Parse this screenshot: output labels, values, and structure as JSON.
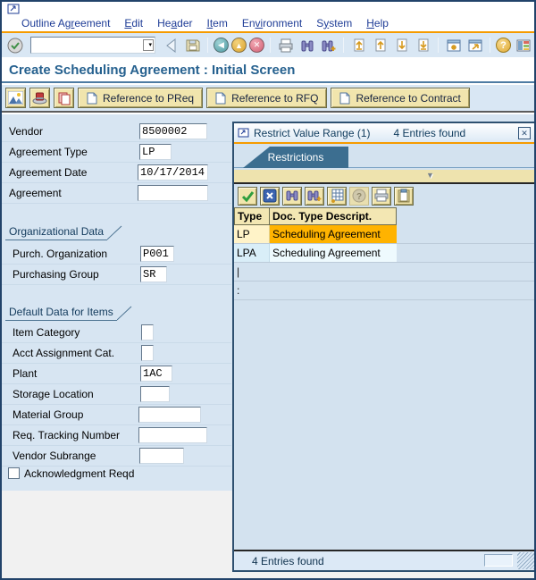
{
  "menu_bar": {
    "items": [
      {
        "label": "Outline Agreement",
        "accel": "gr"
      },
      {
        "label": "Edit",
        "accel": "E"
      },
      {
        "label": "Header",
        "accel": "a"
      },
      {
        "label": "Item",
        "accel": "It"
      },
      {
        "label": "Environment",
        "accel": "vi"
      },
      {
        "label": "System",
        "accel": "y"
      },
      {
        "label": "Help",
        "accel": "H"
      }
    ]
  },
  "toolbar": {
    "command_value": ""
  },
  "screen_title": "Create Scheduling Agreement : Initial Screen",
  "app_toolbar": {
    "buttons": [
      {
        "label": "Reference to PReq"
      },
      {
        "label": "Reference to RFQ"
      },
      {
        "label": "Reference to Contract"
      }
    ]
  },
  "form": {
    "fields": [
      {
        "label": "Vendor",
        "value": "8500002"
      },
      {
        "label": "Agreement Type",
        "value": "LP"
      },
      {
        "label": "Agreement Date",
        "value": "10/17/2014"
      },
      {
        "label": "Agreement",
        "value": ""
      }
    ],
    "org": {
      "title": "Organizational Data",
      "fields": [
        {
          "label": "Purch. Organization",
          "value": "P001"
        },
        {
          "label": "Purchasing Group",
          "value": "SR"
        }
      ]
    },
    "defaults": {
      "title": "Default Data for Items",
      "fields": [
        {
          "label": "Item Category",
          "value": ""
        },
        {
          "label": "Acct Assignment Cat.",
          "value": ""
        },
        {
          "label": "Plant",
          "value": "1AC"
        },
        {
          "label": "Storage Location",
          "value": ""
        },
        {
          "label": "Material Group",
          "value": ""
        },
        {
          "label": "Req. Tracking Number",
          "value": ""
        },
        {
          "label": "Vendor Subrange",
          "value": ""
        }
      ],
      "checkbox": {
        "label": "Acknowledgment Reqd",
        "checked": false
      }
    }
  },
  "popup": {
    "title": "Restrict Value Range (1)",
    "entries_found": "4 Entries found",
    "tab": "Restrictions",
    "table": {
      "headers": [
        "Type",
        "Doc. Type Descript."
      ],
      "rows": [
        {
          "type": "LP",
          "desc": "Scheduling Agreement",
          "selected": true
        },
        {
          "type": "LPA",
          "desc": "Scheduling Agreement",
          "selected": false
        },
        {
          "type": "|",
          "desc": "",
          "selected": false
        },
        {
          "type": ":",
          "desc": "",
          "selected": false
        }
      ]
    },
    "status": "4 Entries found"
  },
  "colors": {
    "accent_orange": "#F59B00",
    "selected_row": "#FFB300",
    "panel_blue": "#D7E5F2",
    "tab_blue": "#3C6E90",
    "button_tan": "#F1E5AD"
  }
}
